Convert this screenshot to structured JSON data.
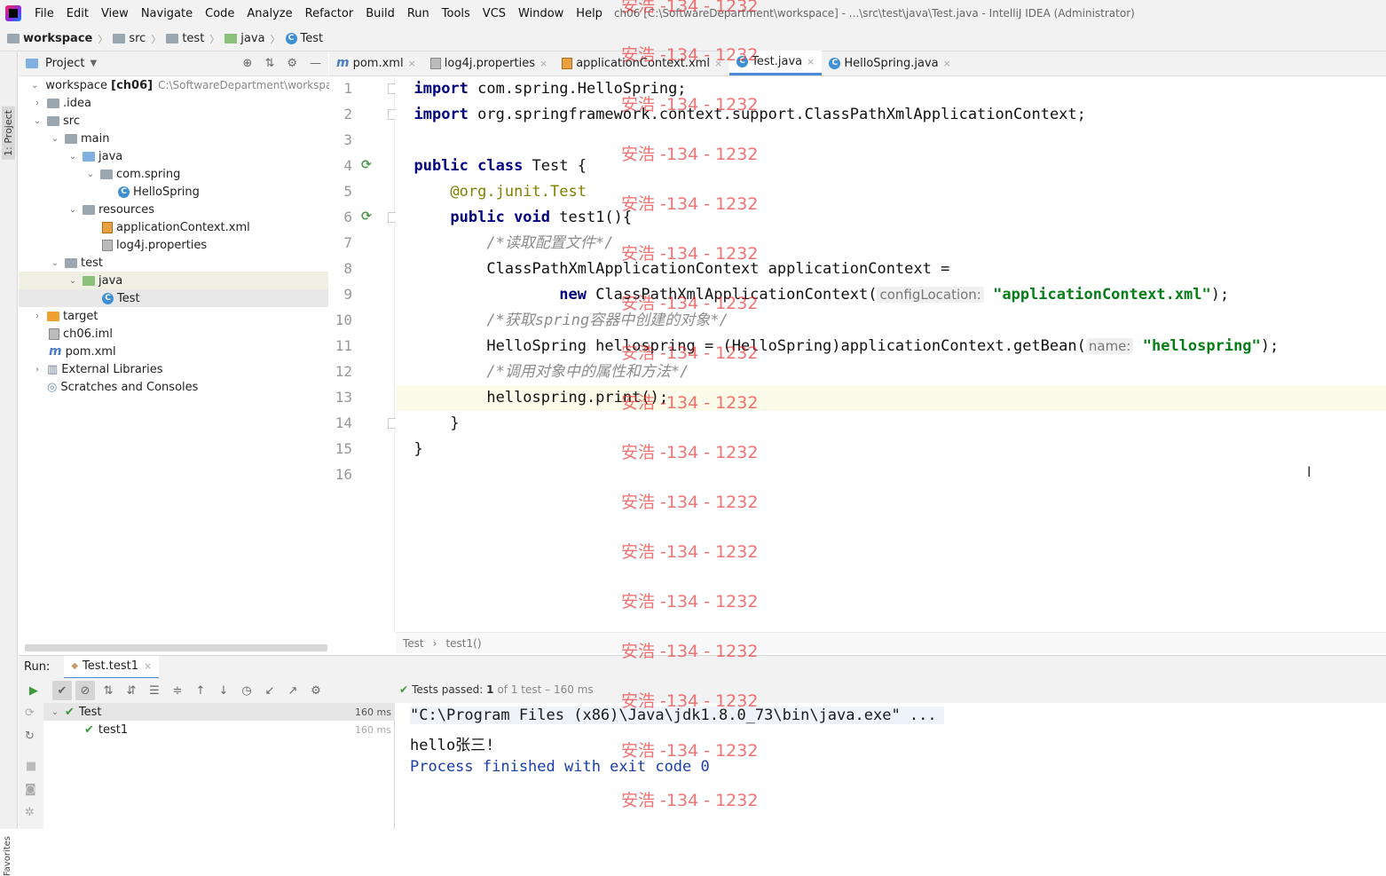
{
  "menubar": {
    "items": [
      "File",
      "Edit",
      "View",
      "Navigate",
      "Code",
      "Analyze",
      "Refactor",
      "Build",
      "Run",
      "Tools",
      "VCS",
      "Window",
      "Help"
    ],
    "window_title": "ch06 [C:\\SoftwareDepartment\\workspace] - ...\\src\\test\\java\\Test.java - IntelliJ IDEA (Administrator)"
  },
  "navbar": {
    "crumbs": [
      "workspace",
      "src",
      "test",
      "java",
      "Test"
    ]
  },
  "sidebar": {
    "strip_label": "1: Project",
    "favorites_label": "Favorites"
  },
  "project": {
    "title": "Project",
    "tree": [
      {
        "label": "workspace",
        "bold": "[ch06]",
        "note": "C:\\SoftwareDepartment\\workspace"
      },
      {
        "label": ".idea"
      },
      {
        "label": "src"
      },
      {
        "label": "main"
      },
      {
        "label": "java"
      },
      {
        "label": "com.spring"
      },
      {
        "label": "HelloSpring"
      },
      {
        "label": "resources"
      },
      {
        "label": "applicationContext.xml"
      },
      {
        "label": "log4j.properties"
      },
      {
        "label": "test"
      },
      {
        "label": "java"
      },
      {
        "label": "Test"
      },
      {
        "label": "target"
      },
      {
        "label": "ch06.iml"
      },
      {
        "label": "pom.xml"
      },
      {
        "label": "External Libraries"
      },
      {
        "label": "Scratches and Consoles"
      }
    ]
  },
  "editor": {
    "tabs": [
      "pom.xml",
      "log4j.properties",
      "applicationContext.xml",
      "Test.java",
      "HelloSpring.java"
    ],
    "active_tab": "Test.java",
    "line_numbers": [
      "1",
      "2",
      "3",
      "4",
      "5",
      "6",
      "7",
      "8",
      "9",
      "10",
      "11",
      "12",
      "13",
      "14",
      "15",
      "16"
    ],
    "code": {
      "l1_kw": "import",
      "l1_rest": " com.spring.HelloSpring;",
      "l2_kw": "import",
      "l2_rest": " org.springframework.context.support.ClassPathXmlApplicationContext;",
      "l4_kw": "public class",
      "l4_rest": " Test {",
      "l5_at": "@org.junit.",
      "l5_ann": "Test",
      "l6_kw": "public void",
      "l6_rest": " test1(){",
      "l7_cmt": "/*读取配置文件*/",
      "l8": "ClassPathXmlApplicationContext applicationContext =",
      "l9_kw": "new",
      "l9_rest": " ClassPathXmlApplicationContext(",
      "l9_hint": "configLocation:",
      "l9_str": "\"applicationContext.xml\"",
      "l9_end": ");",
      "l10_cmt": "/*获取spring容器中创建的对象*/",
      "l11_a": "HelloSpring hellospring = (HelloSpring)applicationContext.getBean(",
      "l11_hint": "name:",
      "l11_str": "\"hellospring\"",
      "l11_end": ");",
      "l12_cmt": "/*调用对象中的属性和方法*/",
      "l13": "hellospring.print();",
      "l14": "}",
      "l15": "}"
    },
    "breadcrumb": [
      "Test",
      "test1()"
    ]
  },
  "run": {
    "label": "Run:",
    "tab": "Test.test1",
    "summary_prefix": "Tests passed:",
    "summary_count": "1",
    "summary_rest": "of 1 test – 160 ms",
    "tree": [
      {
        "label": "Test",
        "time": "160 ms"
      },
      {
        "label": "test1",
        "time": "160 ms"
      }
    ],
    "console": {
      "cmd": "\"C:\\Program Files (x86)\\Java\\jdk1.8.0_73\\bin\\java.exe\" ...",
      "output": "hello张三!",
      "exit": "Process finished with exit code 0"
    }
  },
  "watermark": "安浩 -134 - 1232",
  "colors": {
    "keyword": "#000080",
    "string": "#067d17",
    "annotation": "#808000",
    "comment": "#8c8c8c",
    "pass": "#3c9a3c",
    "tab_accent": "#4a8ad8",
    "watermark": "#eb2828"
  }
}
